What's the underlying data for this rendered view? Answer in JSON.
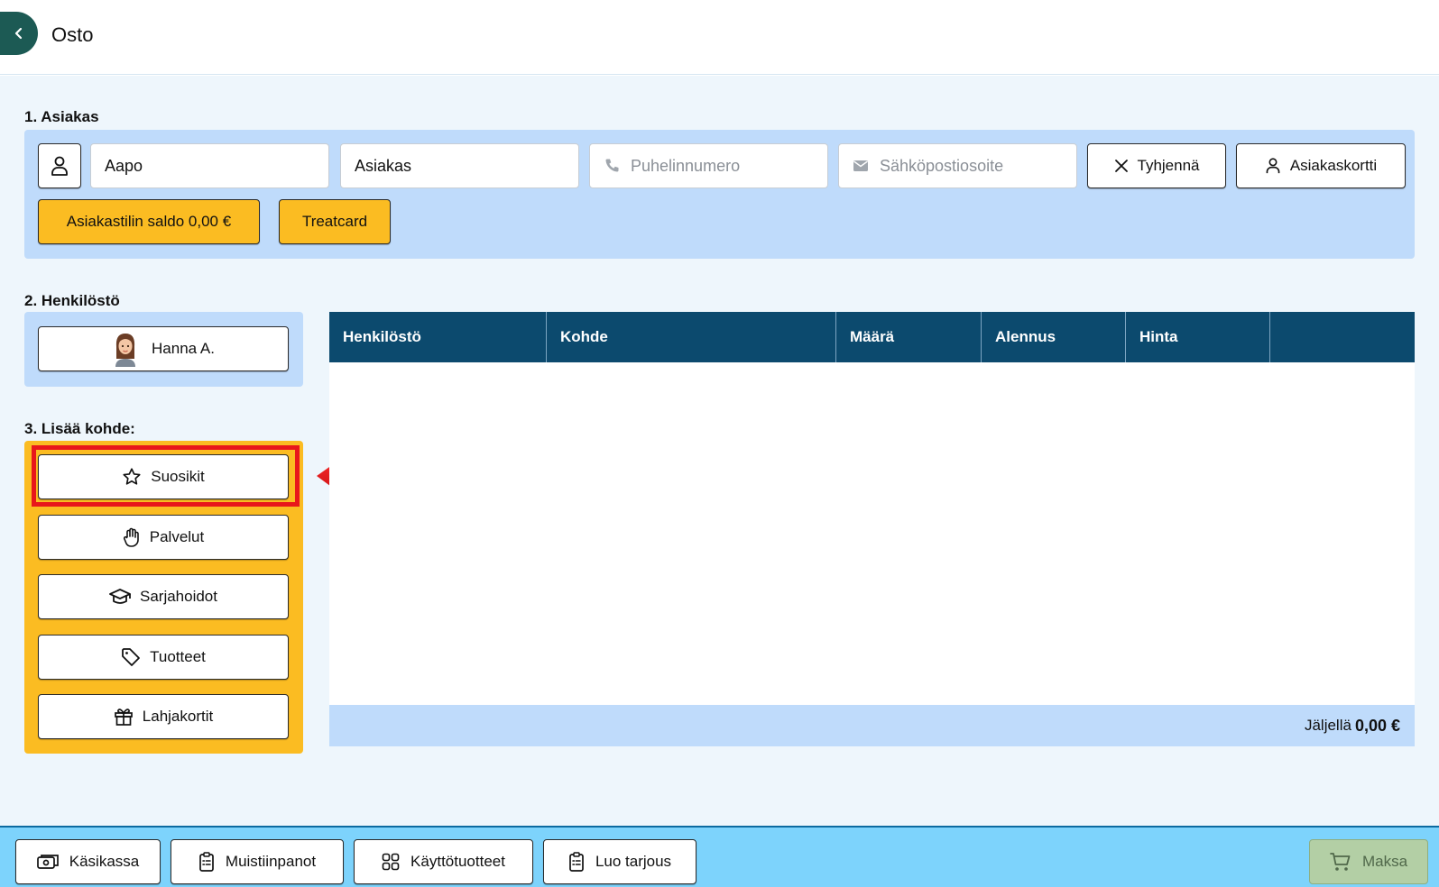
{
  "header": {
    "title": "Osto"
  },
  "sections": {
    "customer": "1. Asiakas",
    "staff": "2. Henkilöstö",
    "add_item": "3. Lisää kohde:"
  },
  "customer": {
    "first_name": "Aapo",
    "last_name": "Asiakas",
    "phone_placeholder": "Puhelinnumero",
    "email_placeholder": "Sähköpostiosoite",
    "clear_label": "Tyhjennä",
    "card_label": "Asiakaskortti",
    "balance_label": "Asiakastilin saldo 0,00 €",
    "treatcard_label": "Treatcard"
  },
  "staff": {
    "selected": "Hanna A."
  },
  "add_items": [
    {
      "label": "Suosikit",
      "icon": "star-icon"
    },
    {
      "label": "Palvelut",
      "icon": "hand-icon"
    },
    {
      "label": "Sarjahoidot",
      "icon": "graduation-cap-icon"
    },
    {
      "label": "Tuotteet",
      "icon": "tag-icon"
    },
    {
      "label": "Lahjakortit",
      "icon": "gift-icon"
    }
  ],
  "table": {
    "columns": [
      "Henkilöstö",
      "Kohde",
      "Määrä",
      "Alennus",
      "Hinta",
      ""
    ],
    "footer_label": "Jäljellä",
    "footer_amount": "0,00 €"
  },
  "bottom": {
    "cash": "Käsikassa",
    "notes": "Muistiinpanot",
    "consumables": "Käyttötuotteet",
    "offer": "Luo tarjous",
    "pay": "Maksa"
  },
  "colors": {
    "accent_dark": "#0c4a6e",
    "panel_blue": "#bfdbfb",
    "yellow": "#fbbc22",
    "highlight_red": "#e8171b",
    "bottom_bar": "#7dd3fc",
    "pay_disabled": "#b3cfa5"
  }
}
